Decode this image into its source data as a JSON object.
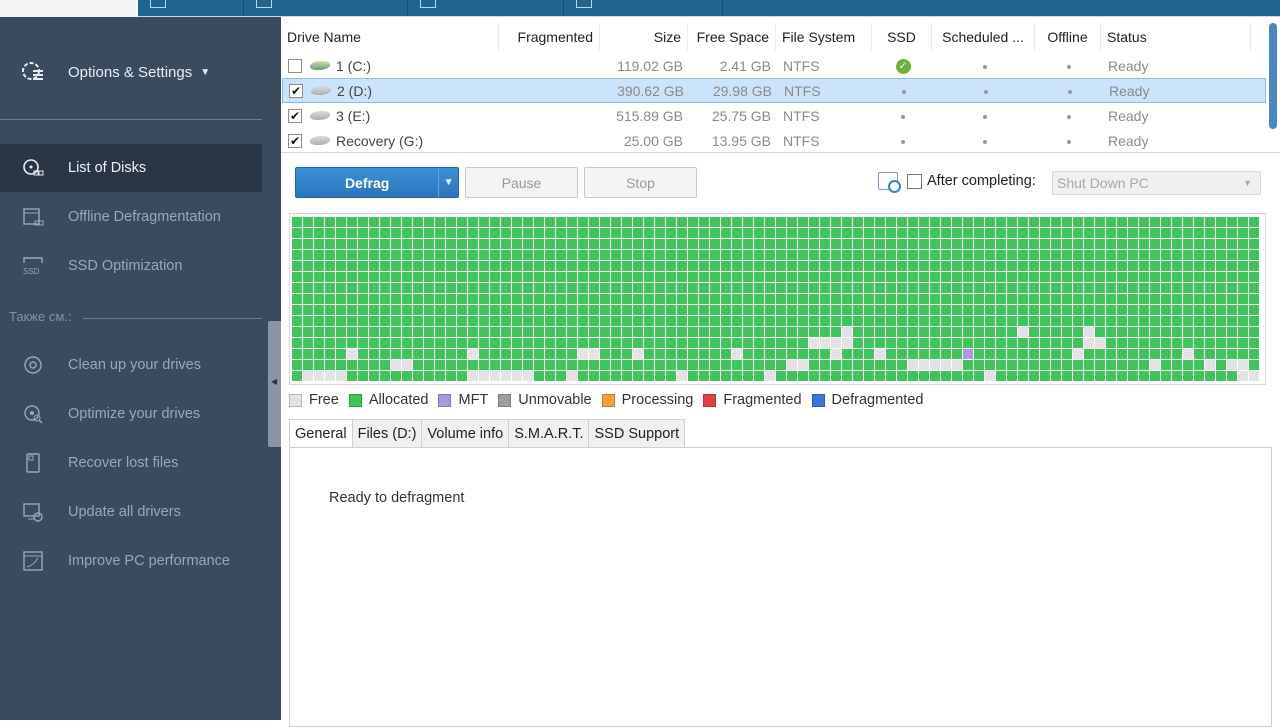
{
  "top_tabs": [
    {
      "icon": "report-icon"
    },
    {
      "icon": "portable-icon"
    },
    {
      "icon": "question-icon"
    },
    {
      "icon": "store-icon"
    }
  ],
  "sidebar": {
    "settings_label": "Options & Settings",
    "items": [
      {
        "label": "List of Disks",
        "icon": "disk-list-icon",
        "active": true
      },
      {
        "label": "Offline Defragmentation",
        "icon": "offline-defrag-icon",
        "active": false
      },
      {
        "label": "SSD Optimization",
        "icon": "ssd-icon",
        "active": false
      }
    ],
    "also_label": "Также см.:",
    "also_items": [
      {
        "label": "Clean up your drives",
        "icon": "clean-drive-icon"
      },
      {
        "label": "Optimize your drives",
        "icon": "optimize-drive-icon"
      },
      {
        "label": "Recover lost files",
        "icon": "recover-files-icon"
      },
      {
        "label": "Update all drivers",
        "icon": "update-drivers-icon"
      },
      {
        "label": "Improve PC performance",
        "icon": "pc-performance-icon"
      }
    ]
  },
  "drive_table": {
    "columns": [
      "Drive Name",
      "Fragmented",
      "Size",
      "Free Space",
      "File System",
      "SSD",
      "Scheduled ...",
      "Offline",
      "Status"
    ],
    "rows": [
      {
        "checked": false,
        "name": "1 (C:)",
        "fragmented": "",
        "size": "119.02 GB",
        "free": "2.41 GB",
        "fs": "NTFS",
        "ssd": true,
        "scheduled": false,
        "offline": false,
        "status": "Ready",
        "selected": false
      },
      {
        "checked": true,
        "name": "2 (D:)",
        "fragmented": "",
        "size": "390.62 GB",
        "free": "29.98 GB",
        "fs": "NTFS",
        "ssd": false,
        "scheduled": false,
        "offline": false,
        "status": "Ready",
        "selected": true
      },
      {
        "checked": true,
        "name": "3 (E:)",
        "fragmented": "",
        "size": "515.89 GB",
        "free": "25.75 GB",
        "fs": "NTFS",
        "ssd": false,
        "scheduled": false,
        "offline": false,
        "status": "Ready",
        "selected": false
      },
      {
        "checked": true,
        "name": "Recovery (G:)",
        "fragmented": "",
        "size": "25.00 GB",
        "free": "13.95 GB",
        "fs": "NTFS",
        "ssd": false,
        "scheduled": false,
        "offline": false,
        "status": "Ready",
        "selected": false
      }
    ]
  },
  "actions": {
    "defrag_label": "Defrag",
    "pause_label": "Pause",
    "stop_label": "Stop",
    "after_completing_label": "After completing:",
    "after_completing_checked": false,
    "after_completing_value": "Shut Down PC"
  },
  "disk_map": {
    "columns": 88,
    "rows": 15,
    "default_state": "allocated",
    "cells": [
      {
        "row": 10,
        "cols": [
          50,
          66,
          72
        ]
      },
      {
        "row": 11,
        "cols": [
          47,
          48,
          49,
          50,
          72,
          73
        ]
      },
      {
        "row": 12,
        "cols": [
          5,
          16,
          26,
          27,
          31,
          40,
          49,
          53,
          71,
          81
        ]
      },
      {
        "row": 13,
        "cols": [
          9,
          10,
          45,
          46,
          56,
          57,
          58,
          59,
          60,
          78,
          83,
          85,
          86
        ]
      },
      {
        "row": 14,
        "cols": [
          1,
          2,
          3,
          4,
          16,
          17,
          18,
          19,
          20,
          21,
          25,
          35,
          43,
          63,
          86,
          87
        ]
      }
    ],
    "mft_cells": [
      {
        "row": 12,
        "col": 61
      }
    ]
  },
  "legend": [
    {
      "label": "Free",
      "color": "#e3e3e3"
    },
    {
      "label": "Allocated",
      "color": "#3fc45a"
    },
    {
      "label": "MFT",
      "color": "#a899de"
    },
    {
      "label": "Unmovable",
      "color": "#9e9e9e"
    },
    {
      "label": "Processing",
      "color": "#f2a03c"
    },
    {
      "label": "Fragmented",
      "color": "#e0404a"
    },
    {
      "label": "Defragmented",
      "color": "#3d74d8"
    }
  ],
  "detail_tabs": [
    {
      "label": "General",
      "active": true
    },
    {
      "label": "Files (D:)",
      "active": false
    },
    {
      "label": "Volume info",
      "active": false
    },
    {
      "label": "S.M.A.R.T.",
      "active": false
    },
    {
      "label": "SSD Support",
      "active": false
    }
  ],
  "general_message": "Ready to defragment"
}
